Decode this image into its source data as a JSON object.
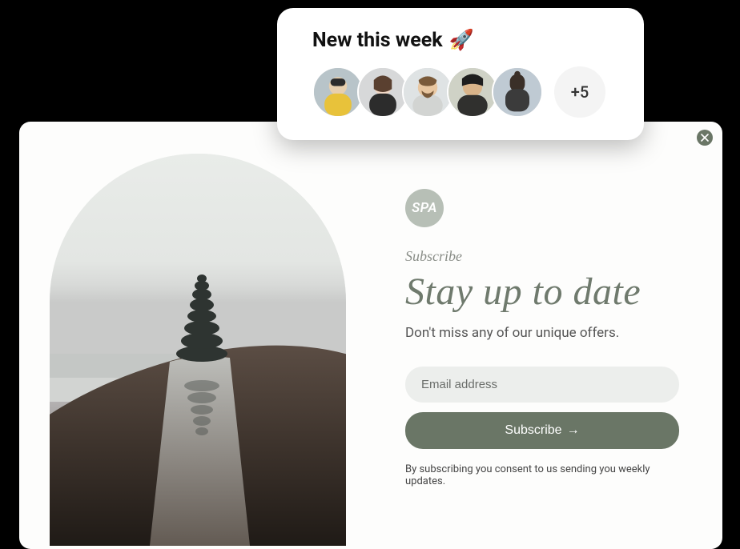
{
  "modal": {
    "brand_text": "SPA",
    "section_label": "Subscribe",
    "headline": "Stay up to date",
    "subhead": "Don't miss any of our unique offers.",
    "email_placeholder": "Email address",
    "button_label": "Subscribe",
    "button_arrow": "→",
    "consent": "By subscribing you consent to us sending you weekly updates.",
    "art_alt": "stacked stones on a log over water in fog"
  },
  "close": {
    "aria": "Close"
  },
  "week": {
    "title": "New this week",
    "emoji": "🚀",
    "avatars": [
      {
        "name": "person-1"
      },
      {
        "name": "person-2"
      },
      {
        "name": "person-3"
      },
      {
        "name": "person-4"
      },
      {
        "name": "person-5"
      }
    ],
    "more_label": "+5"
  },
  "colors": {
    "accent": "#6a7666"
  }
}
